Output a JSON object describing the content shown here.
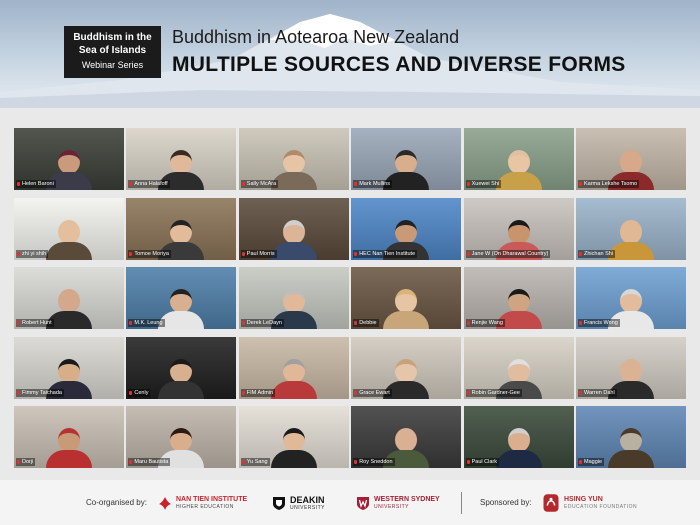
{
  "banner": {
    "series_line1": "Buddhism in the",
    "series_line2": "Sea of Islands",
    "series_line3": "Webinar Series",
    "title": "Buddhism in Aotearoa New Zealand",
    "subtitle": "MULTIPLE SOURCES AND DIVERSE FORMS"
  },
  "participants": [
    {
      "name": "Helen Baroni",
      "bg": "#3a3f37",
      "skin": "#c99a7c",
      "shirt": "#3b3b4a",
      "hair": "#6d2236"
    },
    {
      "name": "Anna Halafoff",
      "bg": "#d8d2c6",
      "skin": "#e0b99a",
      "shirt": "#2c2c2c",
      "hair": "#3a2a20"
    },
    {
      "name": "Sally McAra",
      "bg": "#c9c3b5",
      "skin": "#e6c4a6",
      "shirt": "#7a6a5a",
      "hair": "#b08a6a"
    },
    {
      "name": "Mark Mullins",
      "bg": "#9aa7b8",
      "skin": "#d9ae8c",
      "shirt": "#222",
      "hair": "#2a2a2a"
    },
    {
      "name": "Xuewei Shi",
      "bg": "#8aa08a",
      "skin": "#e8c6a4",
      "shirt": "#c9a04a",
      "hair": "#e0c0a0"
    },
    {
      "name": "Karma Lekshe Tsomo",
      "bg": "#c2b7a8",
      "skin": "#d8a88a",
      "shirt": "#8a2a2a",
      "hair": "#d8a88a"
    },
    {
      "name": "zhi yi shih",
      "bg": "#f2f2ee",
      "skin": "#e3bf9e",
      "shirt": "#5a4a3a",
      "hair": "#e3bf9e"
    },
    {
      "name": "Tomoe Moriya",
      "bg": "#8a7356",
      "skin": "#e2bc9a",
      "shirt": "#3a3a3a",
      "hair": "#222"
    },
    {
      "name": "Paul Morris",
      "bg": "#5a4a3a",
      "skin": "#dcb498",
      "shirt": "#3a4a6a",
      "hair": "#cfcfcf"
    },
    {
      "name": "HEC Nan Tien Institute",
      "bg": "#4d86c7",
      "skin": "#c89a78",
      "shirt": "#333",
      "hair": "#222"
    },
    {
      "name": "Jane W (On Dharawal Country)",
      "bg": "#c8c2bc",
      "skin": "#c7946e",
      "shirt": "#c85a5a",
      "hair": "#1a1a1a"
    },
    {
      "name": "Zhichan Shi",
      "bg": "#9ab3c9",
      "skin": "#e0b896",
      "shirt": "#c9963a",
      "hair": "#e0b896"
    },
    {
      "name": "Robert Hunt",
      "bg": "#d8d8d4",
      "skin": "#d4a88a",
      "shirt": "#2a2a2a",
      "hair": "#d4a88a"
    },
    {
      "name": "M.K. Leung",
      "bg": "#4d7ea8",
      "skin": "#d8b090",
      "shirt": "#e6e6e6",
      "hair": "#222"
    },
    {
      "name": "Derek LeDayn",
      "bg": "#c4c8c0",
      "skin": "#e0b89a",
      "shirt": "#2a3a4a",
      "hair": "#bdbdbd"
    },
    {
      "name": "Debbie",
      "bg": "#6a5642",
      "skin": "#e6c4a4",
      "shirt": "#c9a67a",
      "hair": "#d8b47a"
    },
    {
      "name": "Renjie Wang",
      "bg": "#b9b4ae",
      "skin": "#cfa482",
      "shirt": "#c24a4a",
      "hair": "#1a1a1a"
    },
    {
      "name": "Francis Wong",
      "bg": "#6ea0d2",
      "skin": "#e2bc9c",
      "shirt": "#e8e8e8",
      "hair": "#d8d8d8"
    },
    {
      "name": "Fimmy Taichada",
      "bg": "#d8d6d0",
      "skin": "#d8ae88",
      "shirt": "#2a2a3a",
      "hair": "#1a1a1a"
    },
    {
      "name": "Cenly",
      "bg": "#1f1f1f",
      "skin": "#d8b090",
      "shirt": "#333",
      "hair": "#1a1a1a"
    },
    {
      "name": "FIM Admin",
      "bg": "#c8b8a4",
      "skin": "#e0b898",
      "shirt": "#b83a3a",
      "hair": "#a0a0a0"
    },
    {
      "name": "Grace Ewart",
      "bg": "#cfc8bc",
      "skin": "#e6c6aa",
      "shirt": "#2a2a2a",
      "hair": "#c8a27a"
    },
    {
      "name": "Robin Gardner-Gee",
      "bg": "#d6d0c4",
      "skin": "#e2bc9e",
      "shirt": "#4a4a4a",
      "hair": "#e0e0e0"
    },
    {
      "name": "Warren Dahl",
      "bg": "#d0cbc2",
      "skin": "#dcb294",
      "shirt": "#2a2a2a",
      "hair": "#dcb294"
    },
    {
      "name": "Dorji",
      "bg": "#c8bfb4",
      "skin": "#c89a78",
      "shirt": "#b83030",
      "hair": "#b83030"
    },
    {
      "name": "Maru Bautista",
      "bg": "#bdb4a8",
      "skin": "#d8ae8c",
      "shirt": "#e0e0e0",
      "hair": "#2a1a10"
    },
    {
      "name": "Yu Sang",
      "bg": "#e2ddd4",
      "skin": "#e0ba98",
      "shirt": "#222",
      "hair": "#1a1a1a"
    },
    {
      "name": "Roy Sneddon",
      "bg": "#3a3a3a",
      "skin": "#dab094",
      "shirt": "#4a5a3a",
      "hair": "#dab094"
    },
    {
      "name": "Paul Clark",
      "bg": "#3a4a3a",
      "skin": "#dcae90",
      "shirt": "#1e2a44",
      "hair": "#cfcfcf"
    },
    {
      "name": "Maggie",
      "bg": "#5f86b4",
      "skin": "#b8b0a0",
      "shirt": "#4a3a2a",
      "hair": "#4a3a2a"
    }
  ],
  "footer": {
    "coorganised_label": "Co-organised by:",
    "nantien_name": "NAN TIEN INSTITUTE",
    "nantien_sub": "HIGHER EDUCATION",
    "deakin_name": "DEAKIN",
    "deakin_sub": "UNIVERSITY",
    "wsu_name": "WESTERN SYDNEY",
    "wsu_sub": "UNIVERSITY",
    "sponsored_label": "Sponsored by:",
    "hsingyun_name": "HSING YUN",
    "hsingyun_sub": "EDUCATION FOUNDATION"
  }
}
